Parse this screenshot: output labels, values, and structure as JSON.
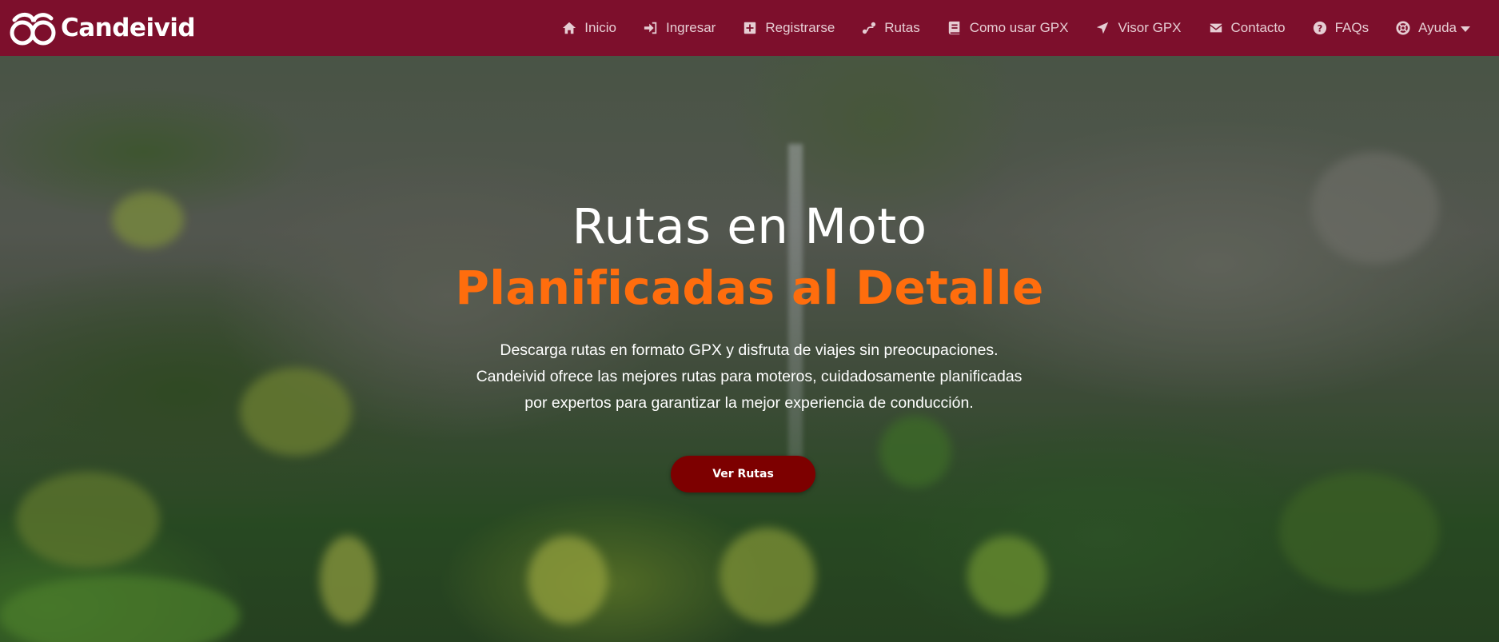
{
  "brand": {
    "name": "Candeivid"
  },
  "nav": {
    "items": [
      {
        "label": "Inicio",
        "icon": "home-icon"
      },
      {
        "label": "Ingresar",
        "icon": "sign-in-icon"
      },
      {
        "label": "Registrarse",
        "icon": "plus-square-icon"
      },
      {
        "label": "Rutas",
        "icon": "route-icon"
      },
      {
        "label": "Como usar GPX",
        "icon": "book-icon"
      },
      {
        "label": "Visor GPX",
        "icon": "location-arrow-icon"
      },
      {
        "label": "Contacto",
        "icon": "envelope-icon"
      },
      {
        "label": "FAQs",
        "icon": "question-circle-icon"
      },
      {
        "label": "Ayuda",
        "icon": "life-ring-icon"
      }
    ]
  },
  "hero": {
    "title_line1": "Rutas en Moto",
    "title_line2": "Planificadas al Detalle",
    "description": [
      "Descarga rutas en formato GPX y disfruta de viajes sin preocupaciones.",
      "Candeivid ofrece las mejores rutas para moteros, cuidadosamente planificadas",
      "por expertos para garantizar la mejor experiencia de conducción."
    ],
    "cta_label": "Ver Rutas"
  },
  "colors": {
    "navbar": "#7d0f2c",
    "accent_orange": "#ff6d0d",
    "cta_background": "#7d0000"
  }
}
